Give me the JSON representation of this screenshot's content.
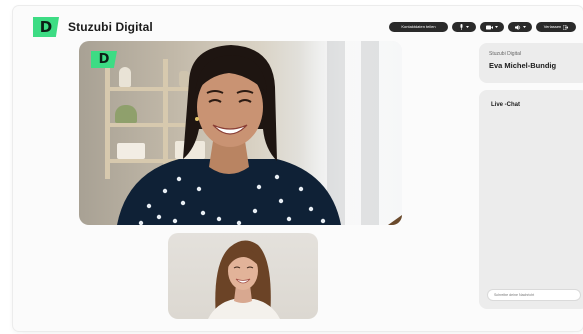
{
  "header": {
    "brand_mark": "D",
    "brand_name": "Stuzubi Digital"
  },
  "toolbar": {
    "share_label": "Kontaktdaten teilen",
    "mic_icon": "microphone-icon",
    "cam_icon": "camera-icon",
    "speaker_icon": "speaker-icon",
    "leave_label": "Verlassen"
  },
  "main_video": {
    "overlay_logo": "D"
  },
  "participant": {
    "org": "Stuzubi Digital",
    "name": "Eva Michel-Bundig"
  },
  "chat": {
    "title": "Live -Chat",
    "input_placeholder": "Schreibe deine Nachricht"
  },
  "colors": {
    "brand_green": "#3ddc84",
    "pill_dark": "#2a2a2a",
    "panel_gray": "#ececec"
  }
}
